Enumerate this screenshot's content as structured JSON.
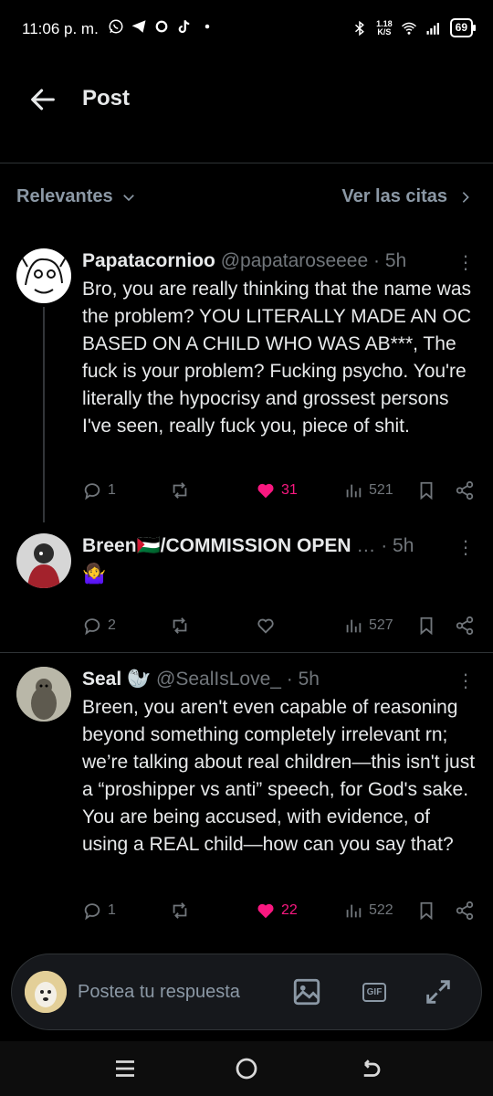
{
  "status_bar": {
    "time": "11:06 p. m.",
    "net_speed_value": "1.18",
    "net_speed_unit": "K/S",
    "battery": "69"
  },
  "header": {
    "title": "Post"
  },
  "sort_bar": {
    "left_label": "Relevantes",
    "right_label": "Ver las citas"
  },
  "posts": [
    {
      "name": "Papatacornioo",
      "handle": "@papataroseeee",
      "dot": "·",
      "time": "5h",
      "text": "Bro, you are really thinking that the name was the problem? YOU LITERALLY MADE AN OC BASED ON A CHILD WHO WAS AB***, The fuck is your problem? Fucking psycho. You're literally the hypocrisy and grossest persons I've seen, really fuck you, piece of shit.",
      "replies": "1",
      "likes": "31",
      "views": "521",
      "liked": true
    },
    {
      "name": "Breen🇵🇸/COMMISSION OPEN",
      "handle": "",
      "dot": "…  ·",
      "time": "5h",
      "text": "🤷‍♀️",
      "replies": "2",
      "likes": "",
      "views": "527",
      "liked": false
    },
    {
      "name": "Seal 🦭",
      "handle": "@SealIsLove_",
      "dot": "·",
      "time": "5h",
      "text": "Breen, you aren't even capable of reasoning beyond something completely irrelevant rn; we’re talking about real children—this isn't just a “proshipper vs anti” speech, for God's sake. You are being accused, with evidence, of using a REAL child—how can you say that?",
      "replies": "1",
      "likes": "22",
      "views": "522",
      "liked": true
    }
  ],
  "reply_bar": {
    "placeholder": "Postea tu respuesta",
    "gif_label": "GIF"
  },
  "colors": {
    "background": "#000000",
    "text": "#e7e9ea",
    "muted": "#71767b",
    "like": "#f91880",
    "divider": "#2f3336"
  }
}
